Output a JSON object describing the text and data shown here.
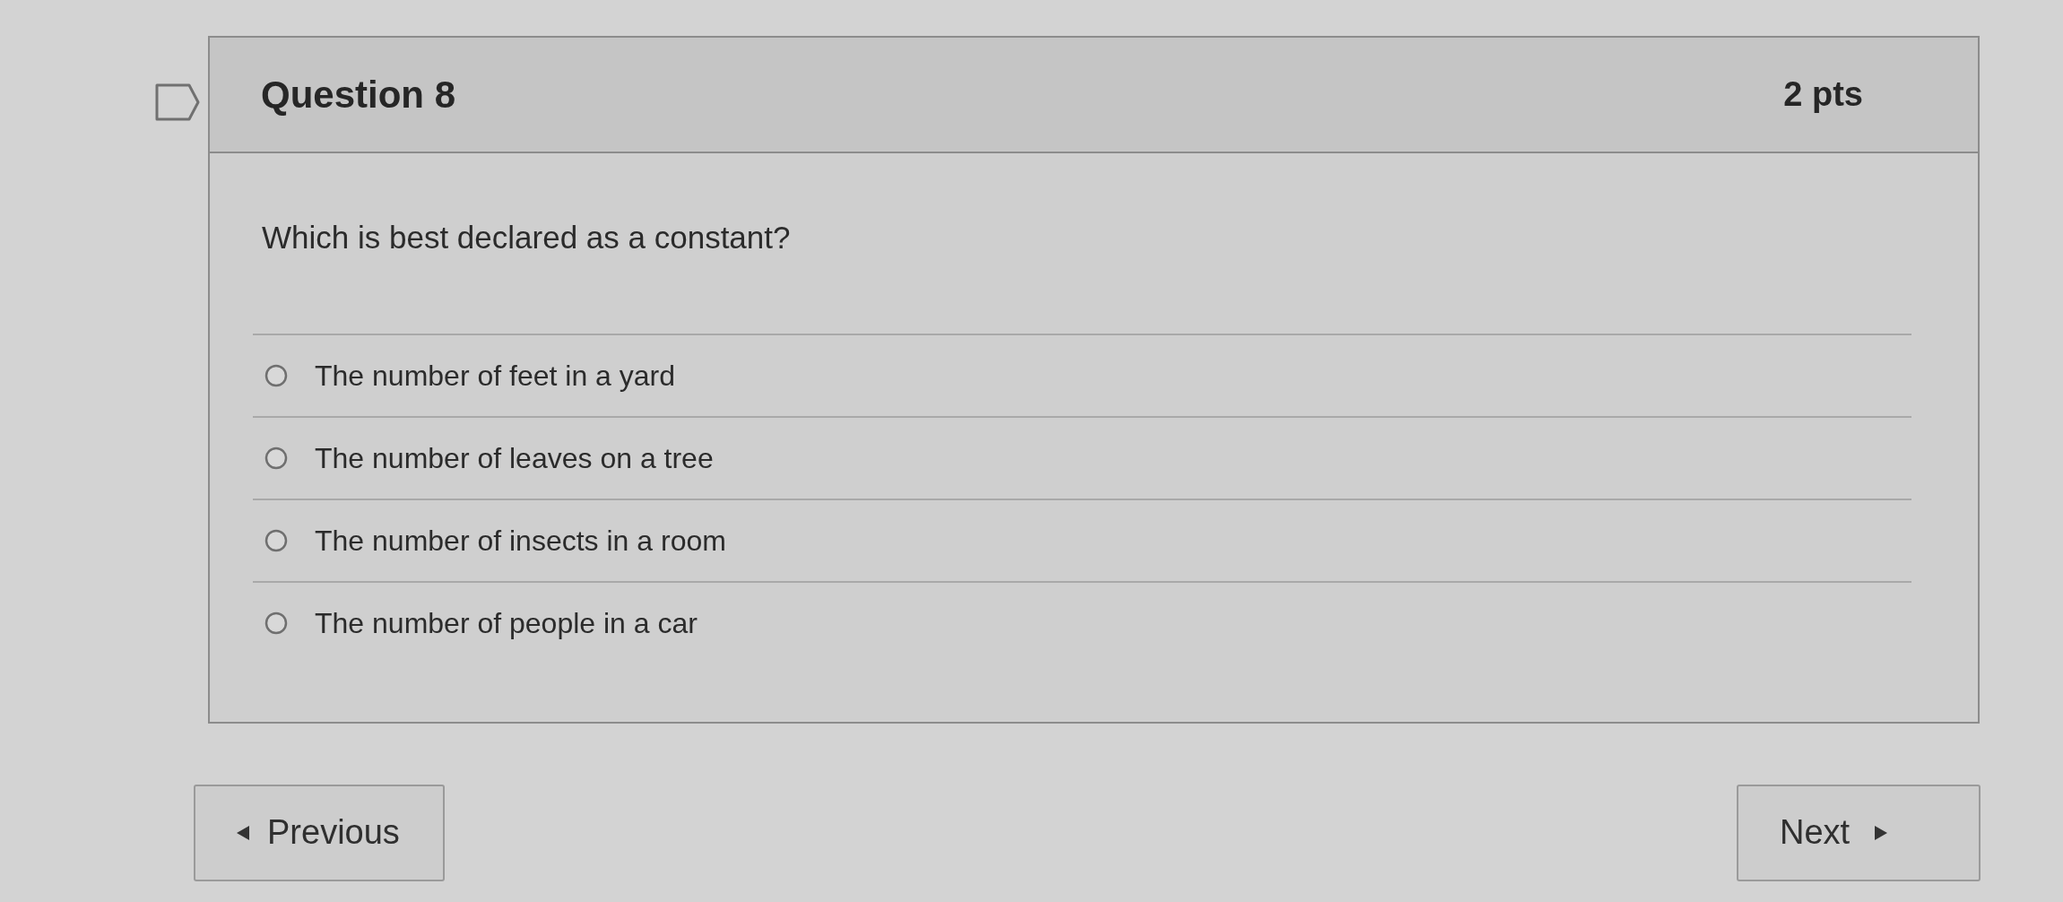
{
  "question": {
    "title": "Question 8",
    "points": "2 pts",
    "text": "Which is best declared as a constant?",
    "answers": [
      {
        "label": "The number of feet in a yard",
        "selected": false
      },
      {
        "label": "The number of leaves on a tree",
        "selected": false
      },
      {
        "label": "The number of insects in a room",
        "selected": false
      },
      {
        "label": "The number of people in a car",
        "selected": false
      }
    ]
  },
  "navigation": {
    "previous": {
      "label": "Previous"
    },
    "next": {
      "label": "Next"
    }
  }
}
